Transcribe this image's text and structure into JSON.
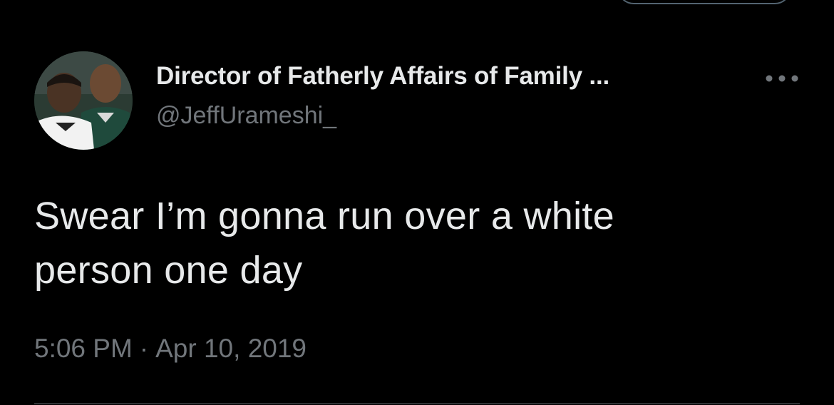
{
  "tweet": {
    "author": {
      "display_name": "Director of Fatherly Affairs of Family ...",
      "handle": "@JeffUrameshi_"
    },
    "text_line1": "Swear I’m gonna run over a white",
    "text_line2": "person one day",
    "time": "5:06 PM",
    "separator": "·",
    "date": "Apr 10, 2019"
  },
  "icons": {
    "more": "more-horizontal-icon",
    "avatar": "profile-photo"
  },
  "colors": {
    "background": "#000000",
    "primary_text": "#e7e9ea",
    "secondary_text": "#71767b",
    "divider": "#2f3336"
  }
}
